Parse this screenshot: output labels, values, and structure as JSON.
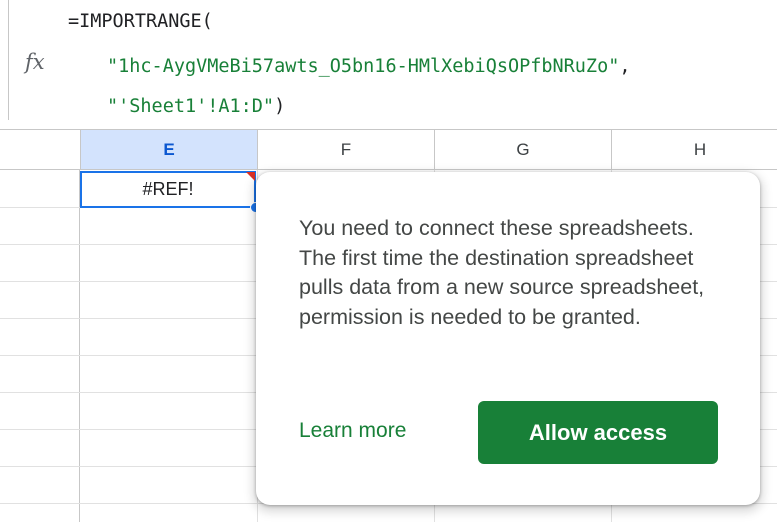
{
  "formula_bar": {
    "fx_label": "fx",
    "line1": "=IMPORTRANGE(",
    "line2_string": "\"1hc-AygVMeBi57awts_O5bn16-HMlXebiQsOPfbNRuZo\"",
    "line2_comma": ",",
    "line3_string": "\"'Sheet1'!A1:D\"",
    "line3_paren": ")"
  },
  "columns": [
    {
      "label": "E",
      "selected": true
    },
    {
      "label": "F",
      "selected": false
    },
    {
      "label": "G",
      "selected": false
    },
    {
      "label": "H",
      "selected": false
    }
  ],
  "active_cell": {
    "value": "#REF!"
  },
  "popup": {
    "message": "You need to connect these spreadsheets. The first time the destination spreadsheet pulls data from a new source spreadsheet, permission is needed to be granted.",
    "learn_more_label": "Learn more",
    "allow_label": "Allow access"
  },
  "colors": {
    "accent": "#1a73e8",
    "selected_header": "#d3e3fd",
    "formula_string": "#188038",
    "primary_button": "#188038",
    "error_flag": "#d93025"
  }
}
